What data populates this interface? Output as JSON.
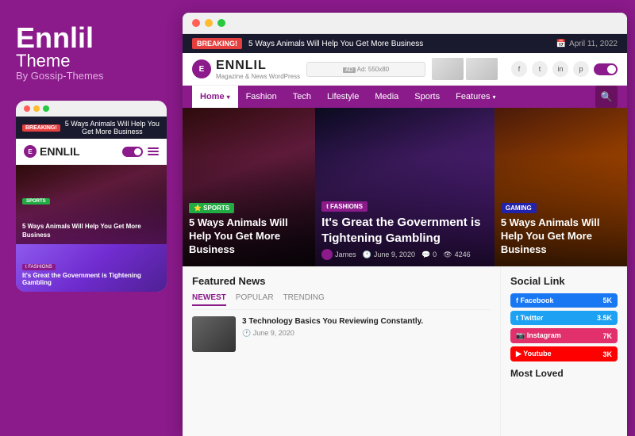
{
  "left": {
    "brand": {
      "title": "Ennlil",
      "subtitle": "Theme",
      "by": "By Gossip-Themes"
    },
    "mobile_preview": {
      "breaking_badge": "BREAKING!",
      "breaking_text": "5 Ways Animals Will Help You Get More Business",
      "logo_text": "ENNLIL",
      "hero_badge": "SPORTS",
      "hero_text": "5 Ways Animals Will Help You Get More Business",
      "fashions_badge": "t  FASHIONS",
      "fashions_title": "It's Great the Government is Tightening Gambling"
    }
  },
  "browser": {
    "breaking": {
      "badge": "BREAKING!",
      "text": "5 Ways Animals Will Help You Get More Business",
      "date": "April 11, 2022"
    },
    "header": {
      "logo_text": "ENNLIL",
      "logo_sub": "Magazine & News WordPress",
      "ad_label": "Ad: 550x80"
    },
    "nav": {
      "items": [
        {
          "label": "Home",
          "dropdown": true,
          "active": true
        },
        {
          "label": "Fashion",
          "dropdown": false
        },
        {
          "label": "Tech",
          "dropdown": false
        },
        {
          "label": "Lifestyle",
          "dropdown": false
        },
        {
          "label": "Media",
          "dropdown": false
        },
        {
          "label": "Sports",
          "dropdown": false
        },
        {
          "label": "Features",
          "dropdown": true
        }
      ]
    },
    "articles": [
      {
        "badge": "SPORTS",
        "badge_class": "badge-sports",
        "title": "5 Ways Animals Will Help You Get More Business",
        "bg_class": "hero-woman-1"
      },
      {
        "badge": "FASHIONS",
        "badge_class": "badge-fashions",
        "title": "It's Great the Government is Tightening Gambling",
        "author": "James",
        "date": "June 9, 2020",
        "comments": "0",
        "views": "4246",
        "bg_class": "hero-woman-2"
      },
      {
        "badge": "GAMING",
        "badge_class": "badge-gaming",
        "title": "5 Ways Animals Will Help You Get More Business",
        "bg_class": "hero-woman-3"
      }
    ],
    "featured": {
      "title": "Featured News",
      "tabs": [
        "NEWEST",
        "POPULAR",
        "TRENDING"
      ],
      "active_tab": "NEWEST",
      "items": [
        {
          "title": "3 Technology Basics You Reviewing Constantly.",
          "date": "June 9, 2020"
        }
      ]
    },
    "social": {
      "title": "Social Link",
      "links": [
        {
          "name": "Facebook",
          "count": "5K",
          "class": "sl-facebook"
        },
        {
          "name": "Twitter",
          "count": "3.5K",
          "class": "sl-twitter"
        },
        {
          "name": "Instagram",
          "count": "7K",
          "class": "sl-instagram"
        },
        {
          "name": "Youtube",
          "count": "3K",
          "class": "sl-youtube"
        }
      ]
    },
    "most_loved": {
      "title": "Most Loved"
    }
  }
}
